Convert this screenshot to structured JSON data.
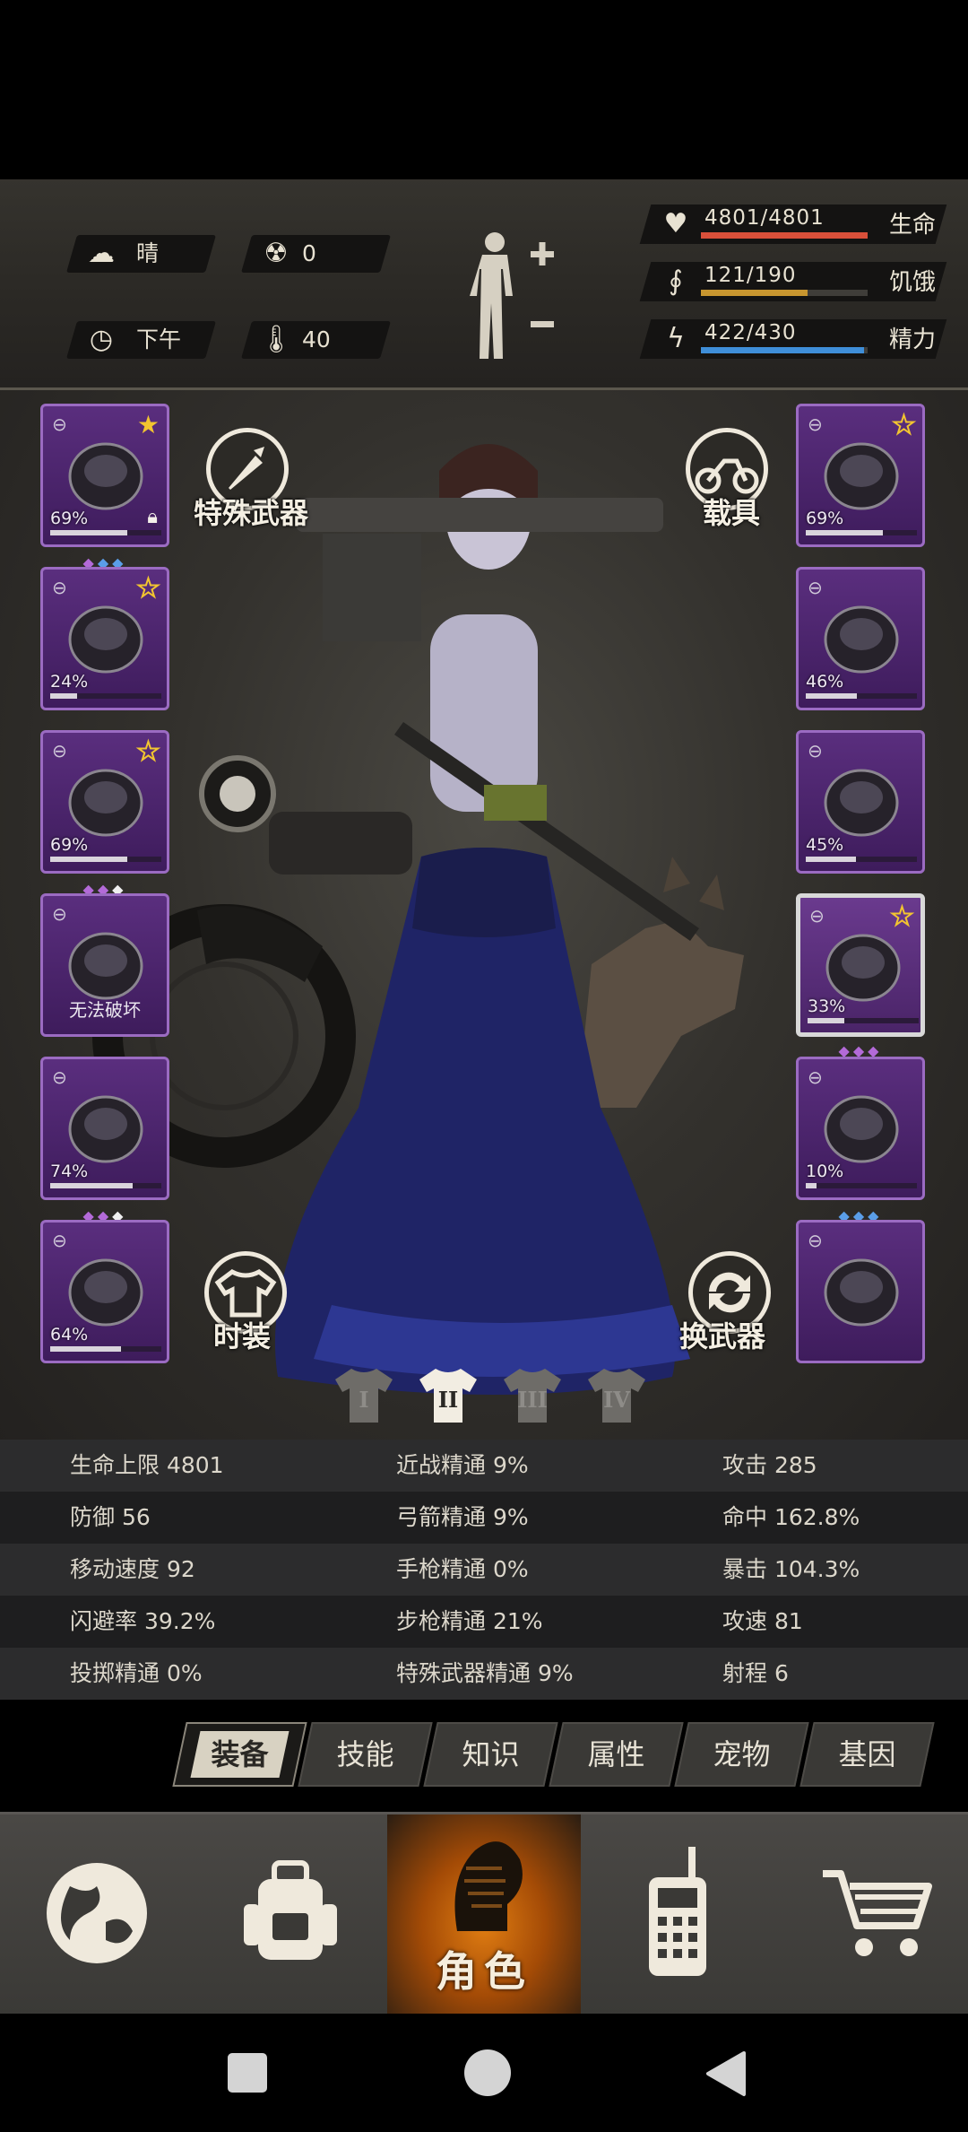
{
  "hud": {
    "weather": "晴",
    "radiation": "0",
    "time_of_day": "下午",
    "temperature": "40",
    "health": {
      "value": "4801/4801",
      "label": "生命",
      "fraction": 1.0,
      "color": "#d9503a"
    },
    "hunger": {
      "value": "121/190",
      "label": "饥饿",
      "fraction": 0.64,
      "color": "#c8962f"
    },
    "energy": {
      "value": "422/430",
      "label": "精力",
      "fraction": 0.98,
      "color": "#3f8ed8"
    }
  },
  "buttons": {
    "special_weapon": "特殊武器",
    "vehicle": "载具",
    "fashion": "时装",
    "swap_weapon": "换武器"
  },
  "left_slots": [
    {
      "name": "helmet",
      "pct": "69%",
      "durability": 0.69,
      "star": "filled",
      "gems": [
        "#b36ad8",
        "#5a9ee8",
        "#5a9ee8"
      ],
      "locked": true
    },
    {
      "name": "jacket",
      "pct": "24%",
      "durability": 0.24,
      "star": "hollow",
      "gems": [],
      "locked": false
    },
    {
      "name": "coat",
      "pct": "69%",
      "durability": 0.69,
      "star": "hollow",
      "gems": [
        "#b36ad8",
        "#b36ad8",
        "#f0f0f0"
      ],
      "locked": false
    },
    {
      "name": "backpack",
      "pct": "",
      "durability": 0,
      "star": "",
      "gems": [],
      "locked": false,
      "status": "无法破坏"
    },
    {
      "name": "pants",
      "pct": "74%",
      "durability": 0.74,
      "star": "",
      "gems": [
        "#b36ad8",
        "#b36ad8",
        "#f0f0f0"
      ],
      "locked": false
    },
    {
      "name": "boots",
      "pct": "64%",
      "durability": 0.64,
      "star": "",
      "gems": [],
      "locked": false
    }
  ],
  "right_slots": [
    {
      "name": "goggles",
      "pct": "69%",
      "durability": 0.69,
      "star": "hollow",
      "gems": []
    },
    {
      "name": "gas-mask",
      "pct": "46%",
      "durability": 0.46,
      "star": "",
      "gems": []
    },
    {
      "name": "vest",
      "pct": "45%",
      "durability": 0.45,
      "star": "",
      "gems": []
    },
    {
      "name": "rifle",
      "pct": "33%",
      "durability": 0.33,
      "star": "hollow",
      "gems": [
        "#b36ad8",
        "#b36ad8",
        "#b36ad8"
      ],
      "selected": true
    },
    {
      "name": "sword",
      "pct": "10%",
      "durability": 0.1,
      "star": "",
      "gems": [
        "#5a9ee8",
        "#5a9ee8",
        "#5a9ee8"
      ]
    },
    {
      "name": "grenade",
      "pct": "",
      "durability": 0,
      "star": "",
      "gems": []
    }
  ],
  "outfit_tabs": [
    "I",
    "II",
    "III",
    "IV"
  ],
  "outfit_active": 1,
  "stats": [
    [
      "生命上限 4801",
      "近战精通 9%",
      "攻击 285"
    ],
    [
      "防御 56",
      "弓箭精通 9%",
      "命中 162.8%"
    ],
    [
      "移动速度 92",
      "手枪精通 0%",
      "暴击 104.3%"
    ],
    [
      "闪避率 39.2%",
      "步枪精通 21%",
      "攻速 81"
    ],
    [
      "投掷精通 0%",
      "特殊武器精通 9%",
      "射程 6"
    ]
  ],
  "tabs": [
    "装备",
    "技能",
    "知识",
    "属性",
    "宠物",
    "基因"
  ],
  "nav": {
    "character_label": "角色"
  }
}
